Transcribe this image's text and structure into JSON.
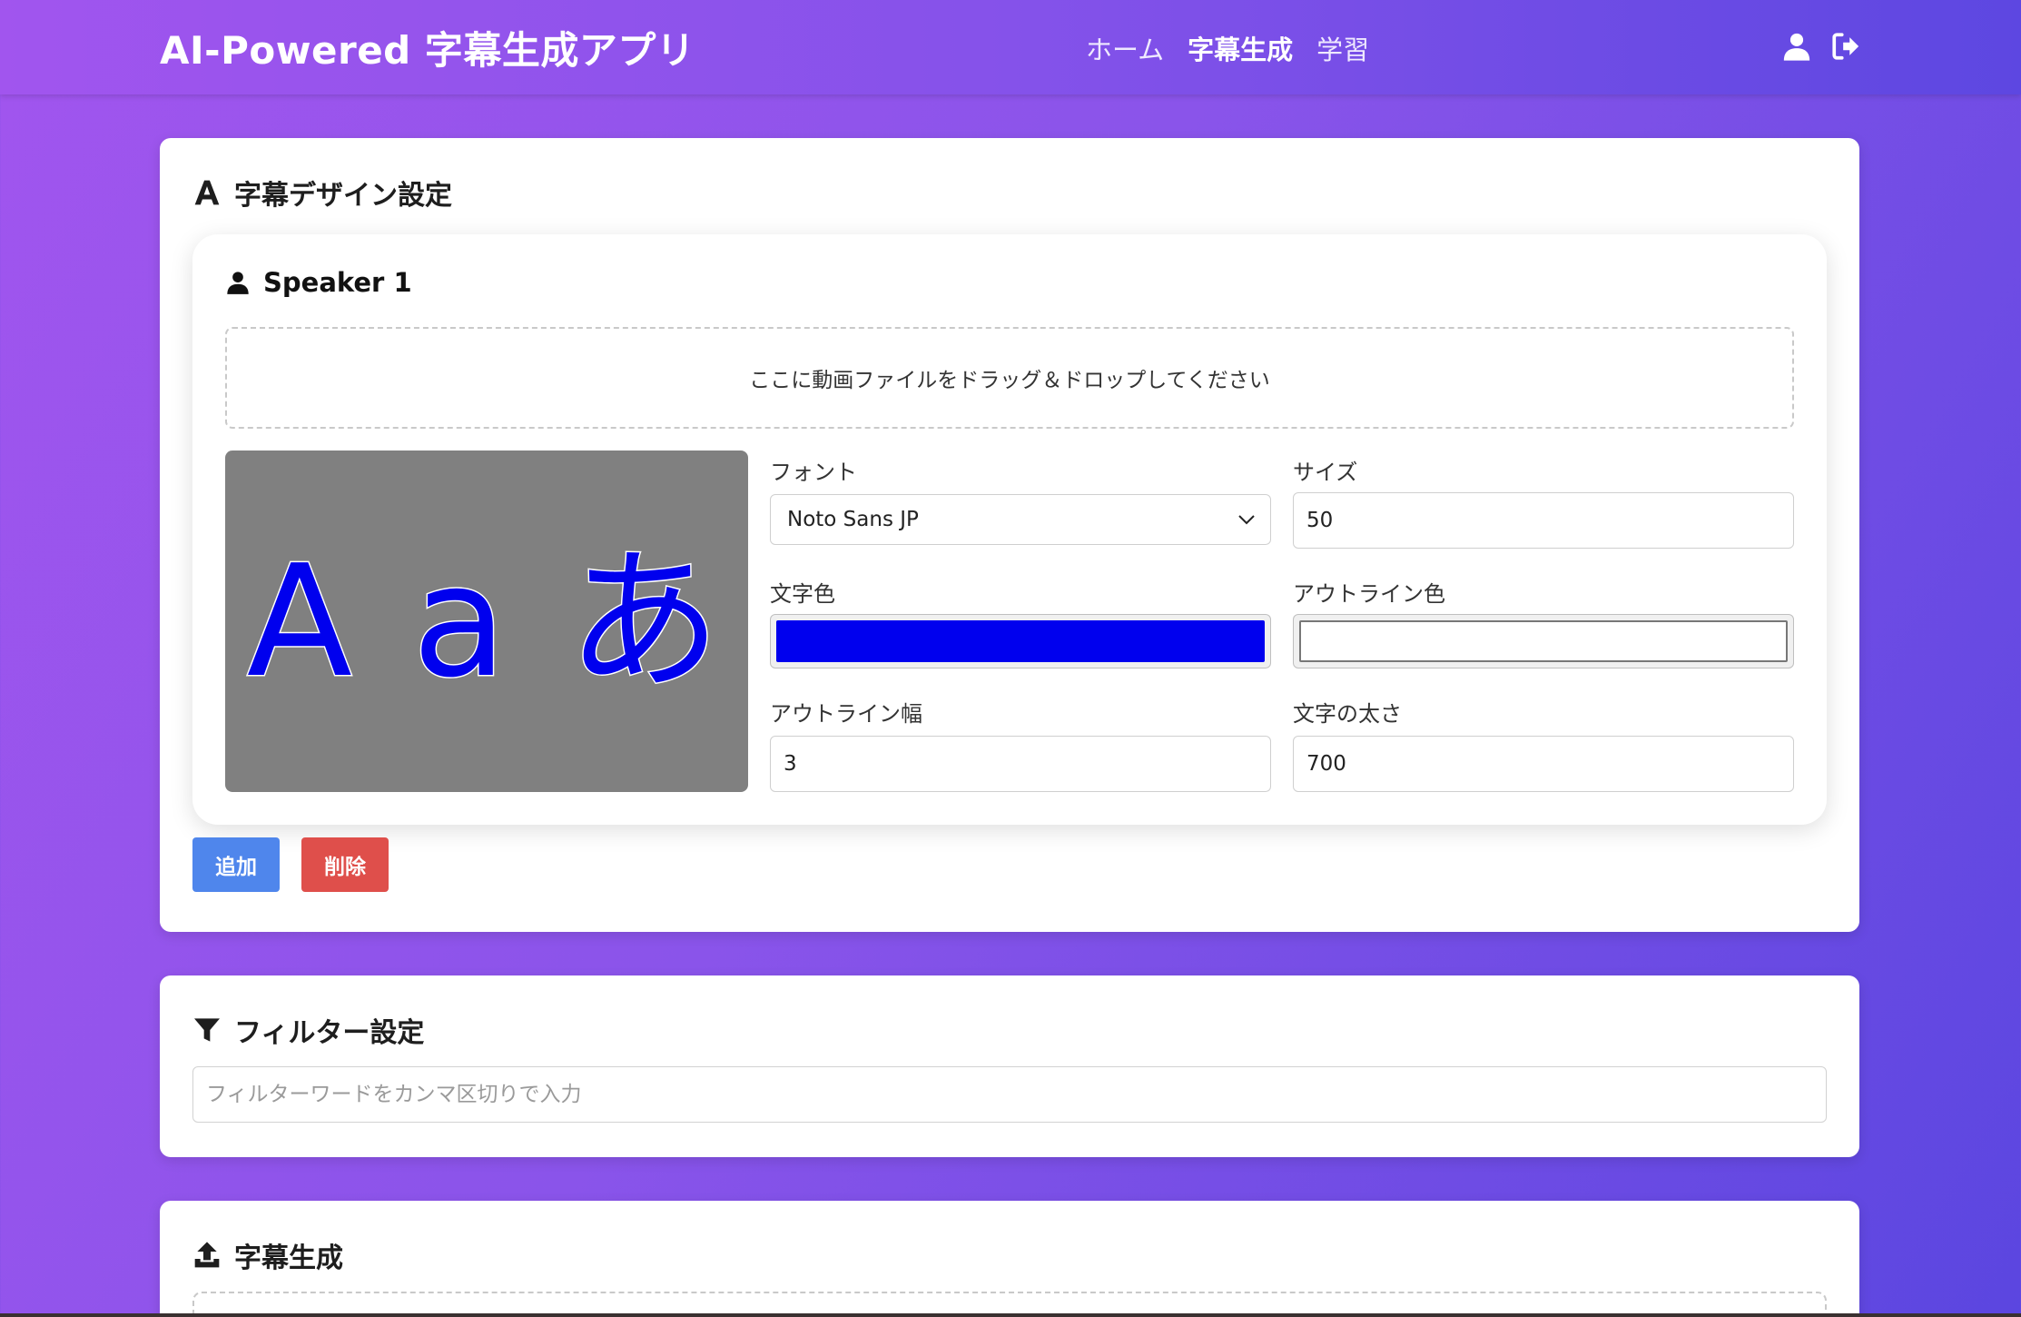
{
  "header": {
    "brand": "AI-Powered 字幕生成アプリ",
    "nav": [
      {
        "label": "ホーム",
        "active": false
      },
      {
        "label": "字幕生成",
        "active": true
      },
      {
        "label": "学習",
        "active": false
      }
    ],
    "icons": [
      "user-icon",
      "logout-icon"
    ]
  },
  "design": {
    "title": "字幕デザイン設定",
    "speaker": {
      "title": "Speaker 1",
      "dropzone_text": "ここに動画ファイルをドラッグ＆ドロップしてください",
      "preview_text": "A a あ",
      "preview_colors": {
        "background": "#808080",
        "text": "#0000ee",
        "outline": "#ffffff"
      },
      "font_label": "フォント",
      "font_value": "Noto Sans JP",
      "size_label": "サイズ",
      "size_value": "50",
      "text_color_label": "文字色",
      "text_color_value": "#0000ee",
      "outline_color_label": "アウトライン色",
      "outline_color_value": "#ffffff",
      "outline_width_label": "アウトライン幅",
      "outline_width_value": "3",
      "weight_label": "文字の太さ",
      "weight_value": "700"
    },
    "add_label": "追加",
    "delete_label": "削除"
  },
  "filter": {
    "title": "フィルター設定",
    "placeholder": "フィルターワードをカンマ区切りで入力",
    "value": ""
  },
  "generate": {
    "title": "字幕生成"
  },
  "colors": {
    "accent_blue": "#4f86ec",
    "danger_red": "#df4f4b",
    "gradient_start": "#a155ee",
    "gradient_end": "#5b46e0"
  }
}
